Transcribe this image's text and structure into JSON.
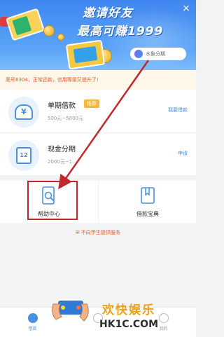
{
  "banner": {
    "title": "邀请好友",
    "subtitle": "最高可赚1999",
    "logo_text": "水象分期"
  },
  "notice": "尾号6304，正常还款，信用等级又提升了!",
  "products": [
    {
      "title": "单期借款",
      "tag": "推荐",
      "range": "500元~5000元",
      "link": "我要借款"
    },
    {
      "title": "现金分期",
      "range": "2000元~1…",
      "link": "申请"
    }
  ],
  "tools": [
    {
      "label": "帮助中心"
    },
    {
      "label": "借款宝典"
    }
  ],
  "footer_note": "不向学生提供服务",
  "tabbar": {
    "items": [
      {
        "label": "借款"
      },
      {
        "label": ""
      },
      {
        "label": "我的"
      }
    ]
  },
  "watermark": {
    "text": "欢快娱乐",
    "site": "HK1C.COM"
  },
  "colors": {
    "accent": "#4a90e2",
    "highlight": "#c2272d",
    "notice": "#e35b2b",
    "tag": "#f7b53a"
  }
}
